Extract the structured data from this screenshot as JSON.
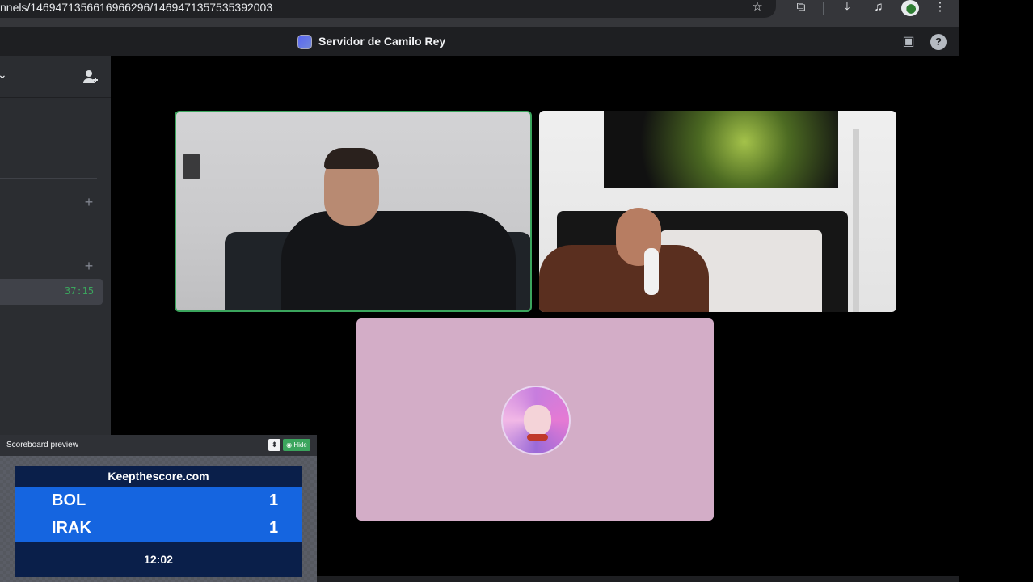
{
  "browser": {
    "url": "nnels/1469471356616966296/1469471357535392003",
    "icons": [
      "star-icon",
      "extensions-icon",
      "download-icon",
      "media-icon",
      "profile-avatar",
      "menu-icon"
    ]
  },
  "app": {
    "server_title": "Servidor de Camilo Rey"
  },
  "sidebar": {
    "active_channel_timer": "37:15"
  },
  "scoreboard": {
    "panel_title": "Scoreboard preview",
    "hide_label": "Hide",
    "site": "Keepthescore.com",
    "teams": [
      {
        "name": "BOL",
        "score": "1"
      },
      {
        "name": "IRAK",
        "score": "1"
      }
    ],
    "clock": "12:02"
  },
  "colors": {
    "speaking_border": "#3ba55d",
    "tile3_background": "#d3adc7",
    "score_blue": "#1565e0",
    "score_navy": "#0a1f4a"
  }
}
